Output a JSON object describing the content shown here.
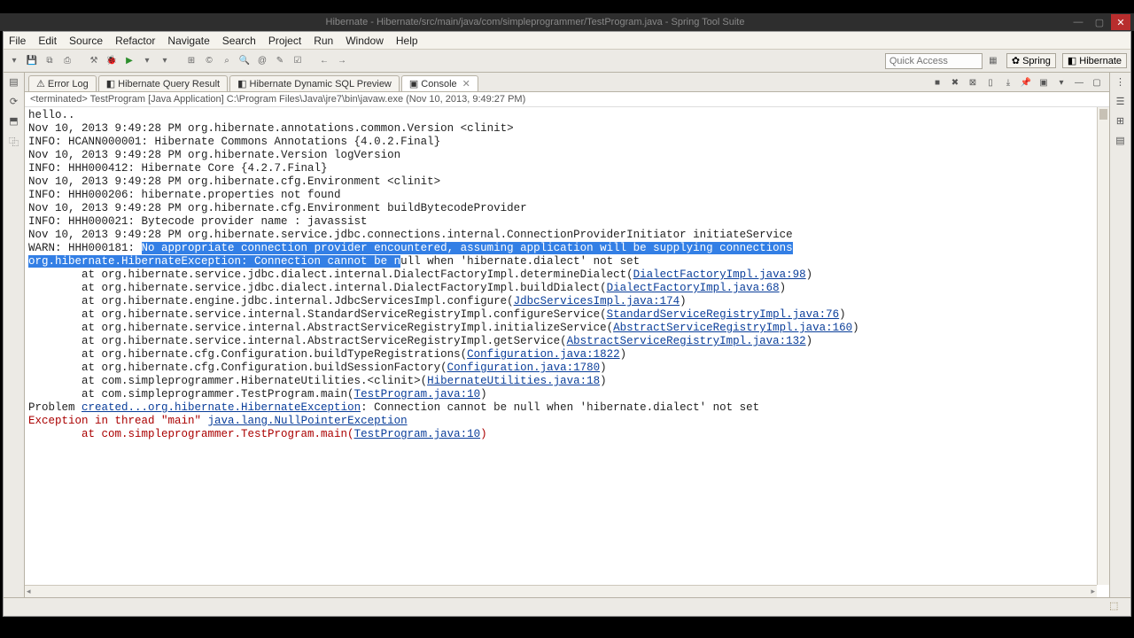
{
  "window_title": "Hibernate - Hibernate/src/main/java/com/simpleprogrammer/TestProgram.java - Spring Tool Suite",
  "menubar": [
    "File",
    "Edit",
    "Source",
    "Refactor",
    "Navigate",
    "Search",
    "Project",
    "Run",
    "Window",
    "Help"
  ],
  "quick_access_placeholder": "Quick Access",
  "perspectives": {
    "spring": "Spring",
    "hibernate": "Hibernate"
  },
  "tabs": {
    "error_log": "Error Log",
    "query_result": "Hibernate Query Result",
    "sql_preview": "Hibernate Dynamic SQL Preview",
    "console": "Console"
  },
  "terminated_label": "<terminated> TestProgram [Java Application] C:\\Program Files\\Java\\jre7\\bin\\javaw.exe (Nov 10, 2013, 9:49:27 PM)",
  "console_lines": {
    "l1": "hello..",
    "l2": "Nov 10, 2013 9:49:28 PM org.hibernate.annotations.common.Version <clinit>",
    "l3": "INFO: HCANN000001: Hibernate Commons Annotations {4.0.2.Final}",
    "l4": "Nov 10, 2013 9:49:28 PM org.hibernate.Version logVersion",
    "l5": "INFO: HHH000412: Hibernate Core {4.2.7.Final}",
    "l6": "Nov 10, 2013 9:49:28 PM org.hibernate.cfg.Environment <clinit>",
    "l7": "INFO: HHH000206: hibernate.properties not found",
    "l8": "Nov 10, 2013 9:49:28 PM org.hibernate.cfg.Environment buildBytecodeProvider",
    "l9": "INFO: HHH000021: Bytecode provider name : javassist",
    "l10": "Nov 10, 2013 9:49:28 PM org.hibernate.service.jdbc.connections.internal.ConnectionProviderInitiator initiateService",
    "warn_prefix": "WARN: HHH000181: ",
    "warn_sel": "No appropriate connection provider encountered, assuming application will be supplying connections",
    "exc_sel": "org.hibernate.HibernateException: Connection cannot be n",
    "exc_rest": "ull when 'hibernate.dialect' not set",
    "at1a": "        at org.hibernate.service.jdbc.dialect.internal.DialectFactoryImpl.determineDialect(",
    "at1b": "DialectFactoryImpl.java:98",
    "at2a": "        at org.hibernate.service.jdbc.dialect.internal.DialectFactoryImpl.buildDialect(",
    "at2b": "DialectFactoryImpl.java:68",
    "at3a": "        at org.hibernate.engine.jdbc.internal.JdbcServicesImpl.configure(",
    "at3b": "JdbcServicesImpl.java:174",
    "at4a": "        at org.hibernate.service.internal.StandardServiceRegistryImpl.configureService(",
    "at4b": "StandardServiceRegistryImpl.java:76",
    "at5a": "        at org.hibernate.service.internal.AbstractServiceRegistryImpl.initializeService(",
    "at5b": "AbstractServiceRegistryImpl.java:160",
    "at6a": "        at org.hibernate.service.internal.AbstractServiceRegistryImpl.getService(",
    "at6b": "AbstractServiceRegistryImpl.java:132",
    "at7a": "        at org.hibernate.cfg.Configuration.buildTypeRegistrations(",
    "at7b": "Configuration.java:1822",
    "at8a": "        at org.hibernate.cfg.Configuration.buildSessionFactory(",
    "at8b": "Configuration.java:1780",
    "at9a": "        at com.simpleprogrammer.HibernateUtilities.<clinit>(",
    "at9b": "HibernateUtilities.java:18",
    "at10a": "        at com.simpleprogrammer.TestProgram.main(",
    "at10b": "TestProgram.java:10",
    "prob_a": "Problem ",
    "prob_b": "created...org.hibernate.HibernateException",
    "prob_c": ": Connection cannot be null when 'hibernate.dialect' not set",
    "exc2a": "Exception in thread \"main\" ",
    "exc2b": "java.lang.NullPointerException",
    "at11a": "        at com.simpleprogrammer.TestProgram.main(",
    "at11b": "TestProgram.java:10"
  }
}
